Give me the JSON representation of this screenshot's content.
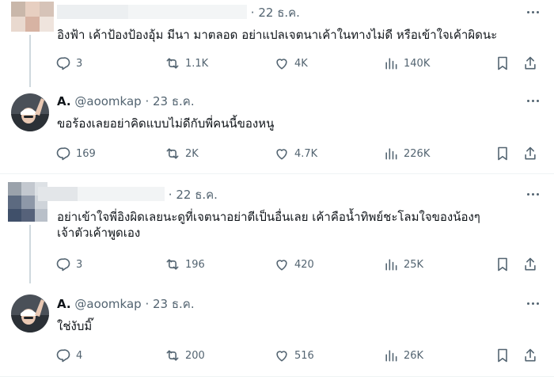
{
  "tweets": [
    {
      "author_name": "",
      "handle": "",
      "date": "22 ธ.ค.",
      "text": "อิงฟ้า เค้าป้องป้องอุ้ม มีนา มาตลอด อย่าแปลเจตนาเค้าในทางไม่ดี หรือเข้าใจเค้าผิดนะ",
      "replies": "3",
      "retweets": "1.1K",
      "likes": "4K",
      "views": "140K"
    },
    {
      "author_name": "A.",
      "handle": "@aoomkap",
      "date": "23 ธ.ค.",
      "text": "ขอร้องเลยอย่าคิดแบบไม่ดีกับพี่คนนี้ของหนู",
      "replies": "169",
      "retweets": "2K",
      "likes": "4.7K",
      "views": "226K"
    },
    {
      "author_name": "",
      "handle": "",
      "date": "22 ธ.ค.",
      "text": "อย่าเข้าใจพี่อิงผิดเลยนะดูที่เจตนาอย่าตีเป็นอื่นเลย เค้าคือน้ำทิพย์ชะโลมใจของน้องๆ\nเจ้าตัวเค้าพูดเอง",
      "replies": "3",
      "retweets": "196",
      "likes": "420",
      "views": "25K"
    },
    {
      "author_name": "A.",
      "handle": "@aoomkap",
      "date": "23 ธ.ค.",
      "text": "ใช่งับมิ๊",
      "replies": "4",
      "retweets": "200",
      "likes": "516",
      "views": "26K"
    }
  ],
  "separator": "·",
  "colors": {
    "text": "#0f1419",
    "secondary": "#536471",
    "divider": "#eff3f4",
    "thread_line": "#cfd9de"
  },
  "icons": [
    "reply-icon",
    "retweet-icon",
    "like-icon",
    "views-icon",
    "bookmark-icon",
    "share-icon",
    "more-icon"
  ]
}
